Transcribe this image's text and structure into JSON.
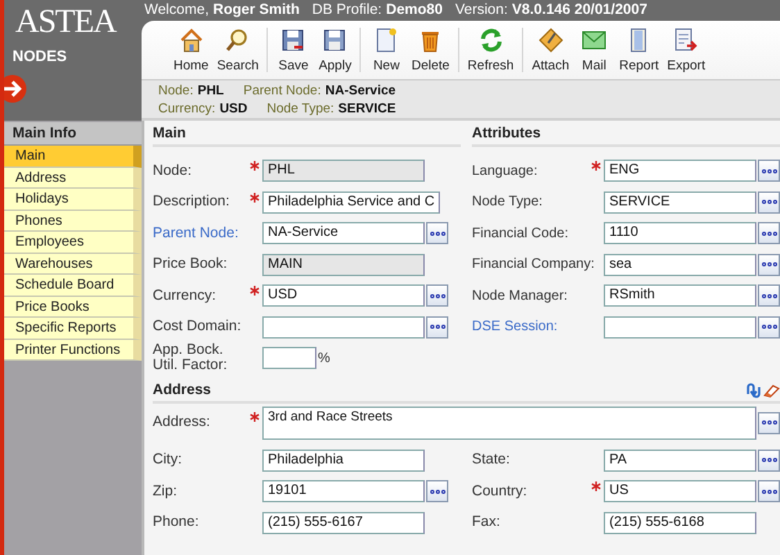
{
  "header": {
    "logo": "ASTEA",
    "module": "NODES",
    "welcome_label": "Welcome,",
    "user": "Roger Smith",
    "profile_label": "DB Profile:",
    "profile": "Demo80",
    "version_label": "Version:",
    "version": "V8.0.146 20/01/2007"
  },
  "toolbar": [
    {
      "label": "Home",
      "kind": "home",
      "separator_after": false
    },
    {
      "label": "Search",
      "kind": "search",
      "separator_after": true
    },
    {
      "label": "Save",
      "kind": "save",
      "separator_after": false
    },
    {
      "label": "Apply",
      "kind": "apply",
      "separator_after": true
    },
    {
      "label": "New",
      "kind": "new",
      "separator_after": false
    },
    {
      "label": "Delete",
      "kind": "delete",
      "separator_after": true
    },
    {
      "label": "Refresh",
      "kind": "refresh",
      "separator_after": true
    },
    {
      "label": "Attach",
      "kind": "attach",
      "separator_after": false
    },
    {
      "label": "Mail",
      "kind": "mail",
      "separator_after": false
    },
    {
      "label": "Report",
      "kind": "report",
      "separator_after": false
    },
    {
      "label": "Export",
      "kind": "export",
      "separator_after": false
    }
  ],
  "summary": [
    [
      {
        "label": "Node:",
        "value": "PHL"
      },
      {
        "label": "Parent Node:",
        "value": "NA-Service"
      }
    ],
    [
      {
        "label": "Currency:",
        "value": "USD"
      },
      {
        "label": "Node Type:",
        "value": "SERVICE"
      }
    ]
  ],
  "sidebar": {
    "title": "Main Info",
    "items": [
      {
        "label": "Main",
        "selected": true
      },
      {
        "label": "Address",
        "selected": false
      },
      {
        "label": "Holidays",
        "selected": false
      },
      {
        "label": "Phones",
        "selected": false
      },
      {
        "label": "Employees",
        "selected": false
      },
      {
        "label": "Warehouses",
        "selected": false
      },
      {
        "label": "Schedule Board",
        "selected": false
      },
      {
        "label": "Price Books",
        "selected": false
      },
      {
        "label": "Specific Reports",
        "selected": false
      },
      {
        "label": "Printer Functions",
        "selected": false
      }
    ]
  },
  "main": {
    "title": "Main",
    "fields": [
      {
        "label": "Node:",
        "value": "PHL",
        "required": true,
        "disabled": true,
        "lookup": false,
        "link": false
      },
      {
        "label": "Description:",
        "value": "Philadelphia Service and C",
        "required": true,
        "disabled": false,
        "lookup": false,
        "link": false
      },
      {
        "label": "Parent Node:",
        "value": "NA-Service",
        "required": false,
        "disabled": false,
        "lookup": true,
        "link": true
      },
      {
        "label": "Price Book:",
        "value": "MAIN",
        "required": false,
        "disabled": true,
        "lookup": false,
        "link": false
      },
      {
        "label": "Currency:",
        "value": "USD",
        "required": true,
        "disabled": false,
        "lookup": true,
        "link": false
      },
      {
        "label": "Cost Domain:",
        "required": false,
        "disabled": false,
        "lookup": true,
        "link": false
      },
      {
        "label": "App. Bock. Util. Factor:",
        "unit": "%",
        "required": false,
        "disabled": false,
        "lookup": false,
        "link": false
      }
    ]
  },
  "attributes": {
    "title": "Attributes",
    "fields": [
      {
        "label": "Language:",
        "value": "ENG",
        "required": true,
        "disabled": false,
        "lookup": true,
        "link": false
      },
      {
        "label": "Node Type:",
        "value": "SERVICE",
        "required": false,
        "disabled": false,
        "lookup": true,
        "link": false
      },
      {
        "label": "Financial Code:",
        "value": "1110",
        "required": false,
        "disabled": false,
        "lookup": true,
        "link": false
      },
      {
        "label": "Financial Company:",
        "value": "sea",
        "required": false,
        "disabled": false,
        "lookup": true,
        "link": false
      },
      {
        "label": "Node Manager:",
        "value": "RSmith",
        "required": false,
        "disabled": false,
        "lookup": true,
        "link": false
      },
      {
        "label": "DSE Session:",
        "required": false,
        "disabled": false,
        "lookup": true,
        "link": true
      }
    ]
  },
  "address": {
    "title": "Address",
    "address_line": {
      "label": "Address:",
      "value": "3rd and Race Streets",
      "required": true,
      "disabled": false,
      "lookup": true
    },
    "rows": [
      [
        {
          "label": "City:",
          "value": "Philadelphia",
          "required": false,
          "disabled": false,
          "lookup": false,
          "link": false
        },
        {
          "label": "State:",
          "value": "PA",
          "required": false,
          "disabled": false,
          "lookup": true,
          "link": false
        }
      ],
      [
        {
          "label": "Zip:",
          "value": "19101",
          "required": false,
          "disabled": false,
          "lookup": true,
          "link": false
        },
        {
          "label": "Country:",
          "value": "US",
          "required": true,
          "disabled": false,
          "lookup": true,
          "link": false
        }
      ],
      [
        {
          "label": "Phone:",
          "value": "(215) 555-6167",
          "required": false,
          "disabled": false,
          "lookup": false,
          "link": false
        },
        {
          "label": "Fax:",
          "value": "(215) 555-6168",
          "required": false,
          "disabled": false,
          "lookup": false,
          "link": false
        }
      ]
    ]
  }
}
